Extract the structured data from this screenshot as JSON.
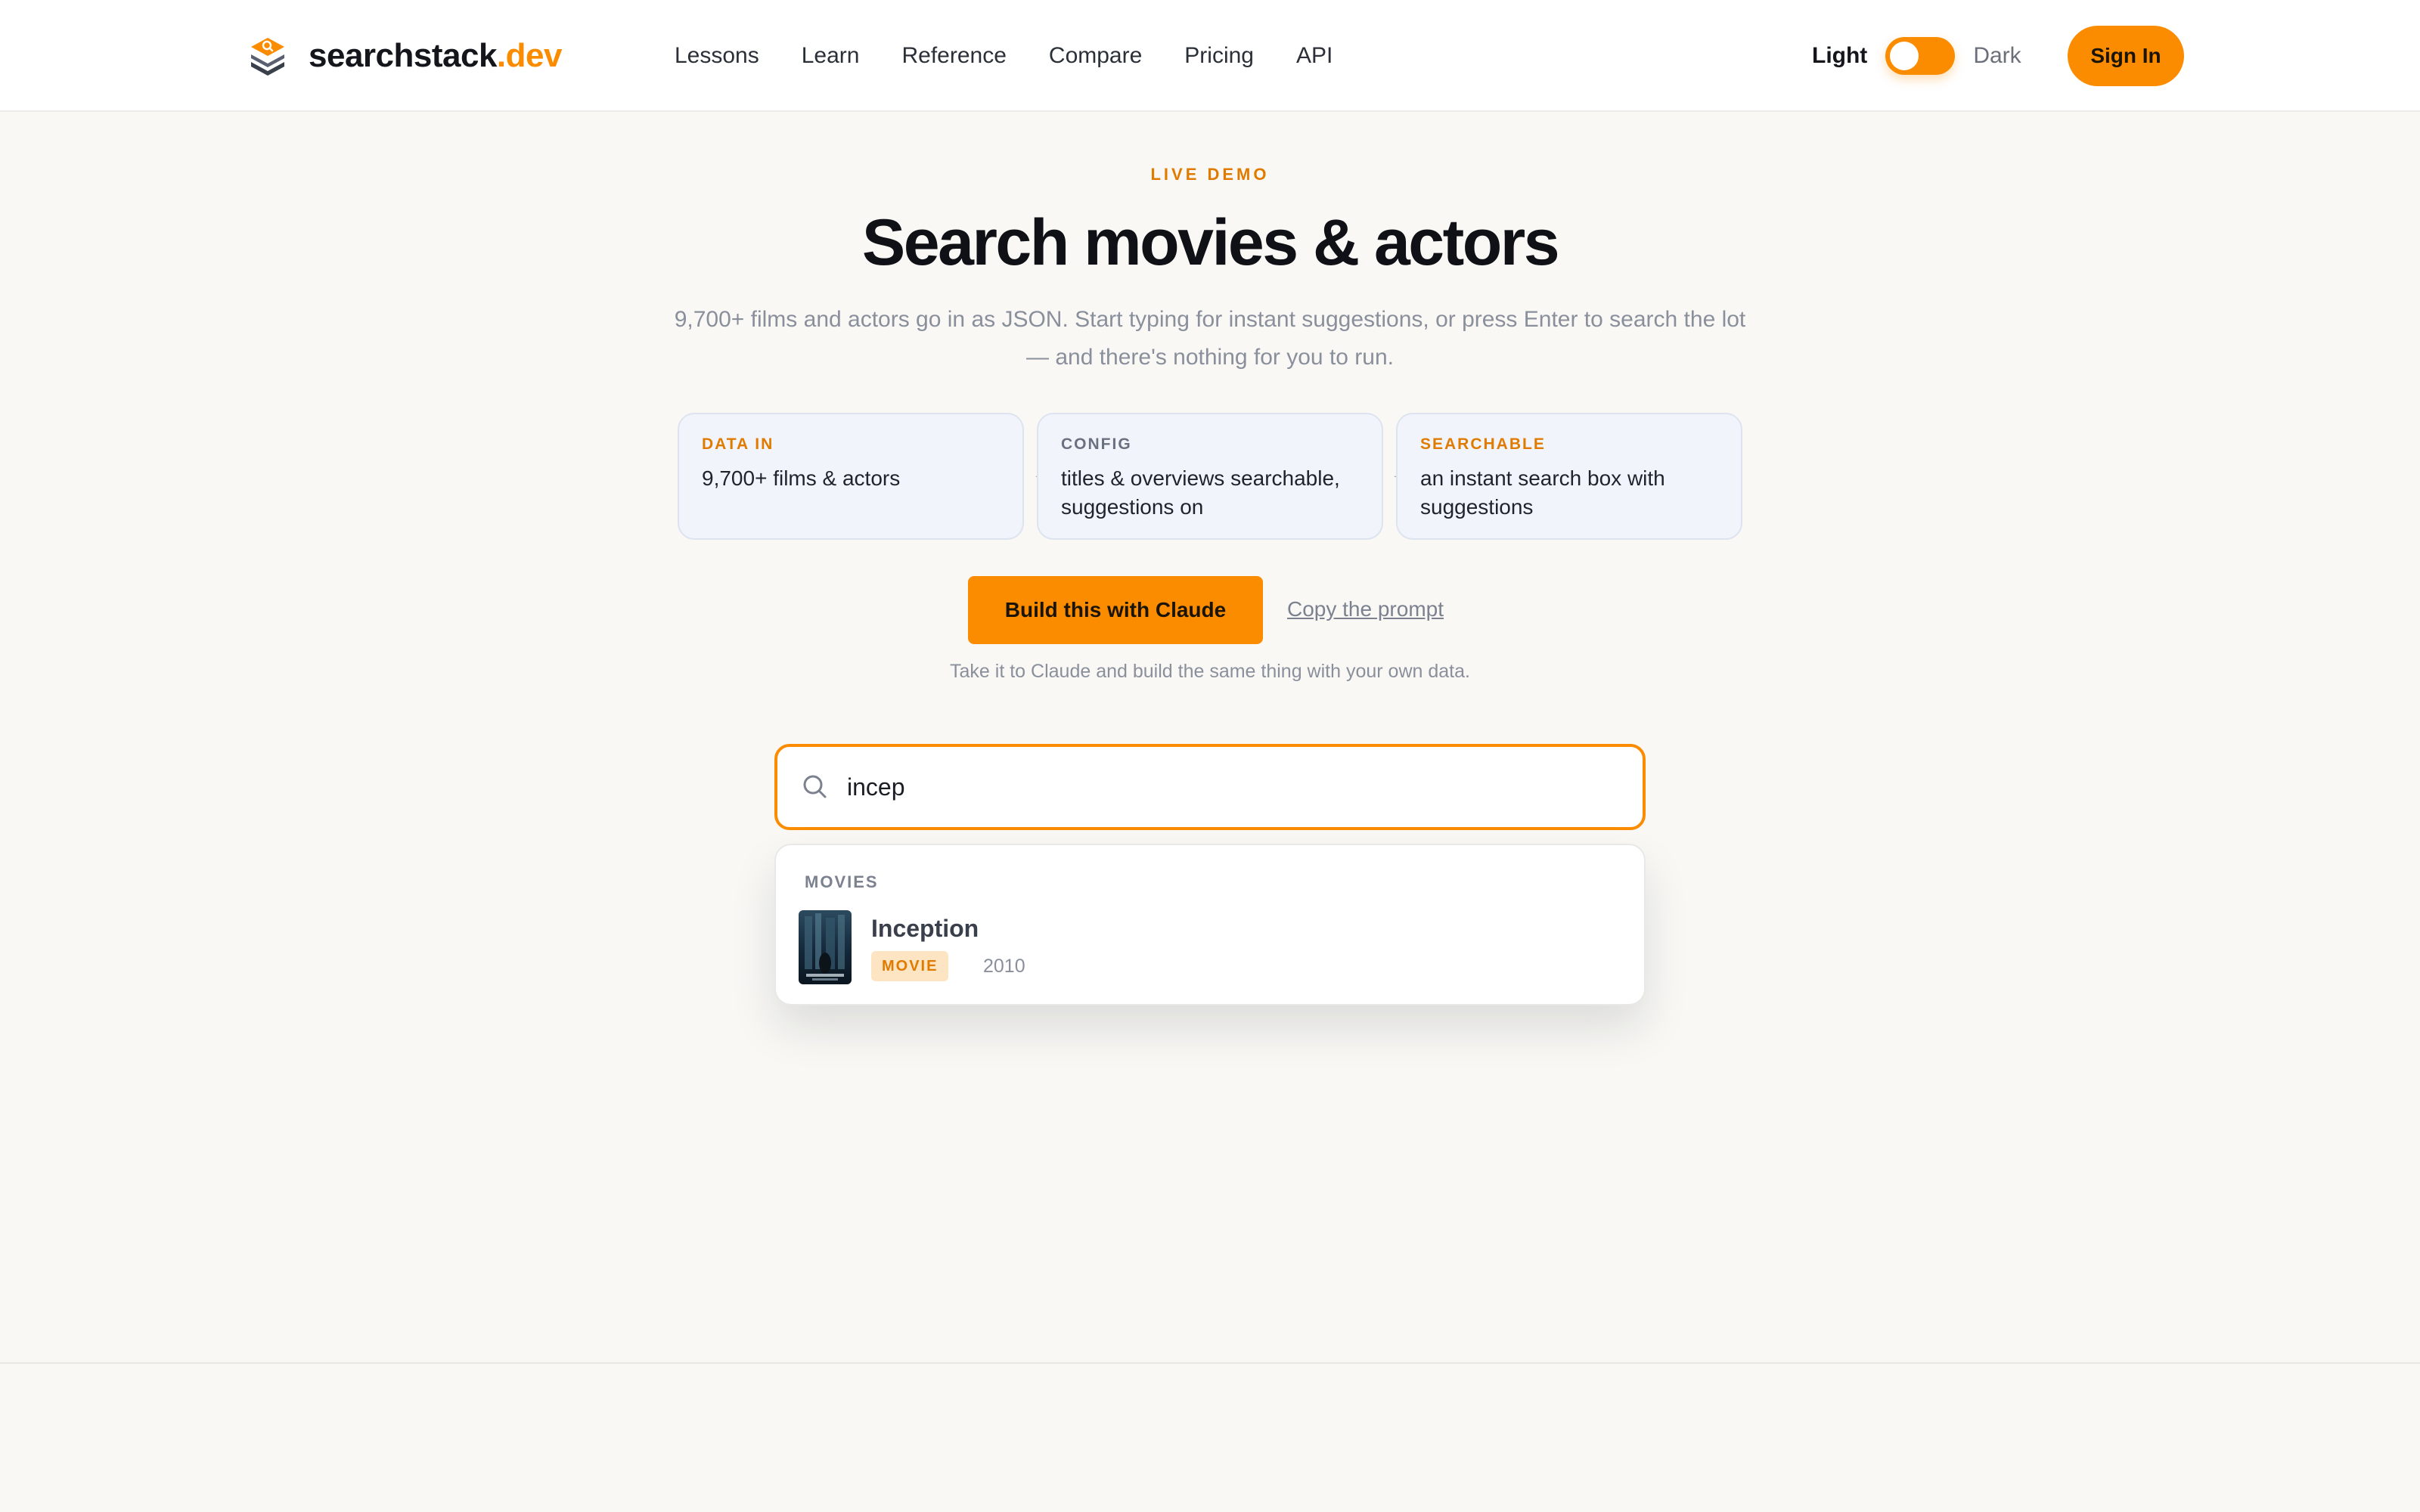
{
  "header": {
    "brand": {
      "name": "searchstack",
      "tld": ".dev"
    },
    "nav": [
      "Lessons",
      "Learn",
      "Reference",
      "Compare",
      "Pricing",
      "API"
    ],
    "theme": {
      "light_label": "Light",
      "dark_label": "Dark"
    },
    "signin_label": "Sign In"
  },
  "hero": {
    "eyebrow": "LIVE DEMO",
    "title": "Search movies & actors",
    "subtitle": "9,700+ films and actors go in as JSON. Start typing for instant suggestions, or press Enter to search the lot — and there's nothing for you to run."
  },
  "pipeline": [
    {
      "kicker": "DATA IN",
      "text": "9,700+ films & actors"
    },
    {
      "kicker": "CONFIG",
      "text": "titles & overviews searchable, suggestions on"
    },
    {
      "kicker": "SEARCHABLE",
      "text": "an instant search box with suggestions"
    }
  ],
  "cta": {
    "build_label": "Build this with Claude",
    "copy_label": "Copy the prompt",
    "note": "Take it to Claude and build the same thing with your own data."
  },
  "search": {
    "value": "incep",
    "icon": "search-icon"
  },
  "results": {
    "group_label": "MOVIES",
    "items": [
      {
        "title": "Inception",
        "badge": "MOVIE",
        "year": "2010"
      }
    ]
  },
  "colors": {
    "accent": "#fb8c00",
    "background": "#f9f8f5",
    "card_bg": "#f1f4fb"
  }
}
